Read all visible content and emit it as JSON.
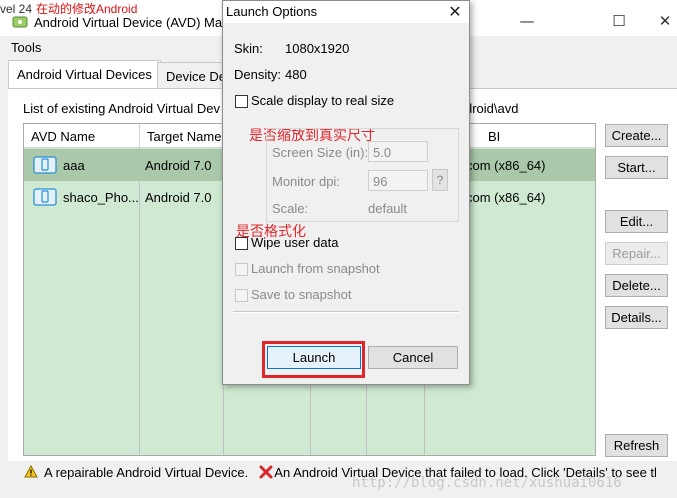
{
  "window": {
    "title": "Android Virtual Device (AVD) Ma",
    "background_fragments": {
      "left": "vel 24",
      "red": "在动的修改Android"
    },
    "buttons": {
      "minimize": "—",
      "maximize": "☐",
      "close": "✕"
    }
  },
  "menu": {
    "tools": "Tools"
  },
  "tabs": [
    {
      "label": "Android Virtual Devices",
      "active": true
    },
    {
      "label": "Device De",
      "active": false
    }
  ],
  "list": {
    "label": "List of existing Android Virtual Dev",
    "path_suffix": "droid\\avd",
    "columns": [
      "AVD Name",
      "Target Name",
      "",
      "",
      "BI"
    ],
    "rows": [
      {
        "name": "aaa",
        "target": "Android 7.0",
        "abi": "com (x86_64)",
        "selected": true,
        "icon": "device-icon"
      },
      {
        "name": "shaco_Pho...",
        "target": "Android 7.0",
        "abi": "com (x86_64)",
        "selected": false,
        "icon": "device-icon"
      }
    ]
  },
  "side_buttons": [
    {
      "label": "Create...",
      "enabled": true
    },
    {
      "label": "Start...",
      "enabled": true
    },
    {
      "label": "Edit...",
      "enabled": true
    },
    {
      "label": "Repair...",
      "enabled": false
    },
    {
      "label": "Delete...",
      "enabled": true
    },
    {
      "label": "Details...",
      "enabled": true
    },
    {
      "label": "Refresh",
      "enabled": true
    }
  ],
  "status": {
    "warning_icon": "warning-icon",
    "error_icon": "error-x-icon",
    "warning_text": "A repairable Android Virtual Device.",
    "error_text": "An Android Virtual Device that failed to load. Click 'Details' to see tl"
  },
  "watermark": "http://blog.csdn.net/xushuai0616",
  "dialog": {
    "title": "Launch Options",
    "skin_label": "Skin:",
    "skin_value": "1080x1920",
    "density_label": "Density:",
    "density_value": "480",
    "scale_display_label": "Scale display to real size",
    "scale_display_checked": false,
    "screen_size_label": "Screen Size (in):",
    "screen_size_value": "5.0",
    "monitor_dpi_label": "Monitor dpi:",
    "monitor_dpi_value": "96",
    "help_label": "?",
    "scale_label": "Scale:",
    "scale_value": "default",
    "wipe_label": "Wipe user data",
    "wipe_checked": false,
    "launch_snapshot_label": "Launch from snapshot",
    "save_snapshot_label": "Save to snapshot",
    "launch_button": "Launch",
    "cancel_button": "Cancel",
    "annotation_scale": "是否缩放到真实尺寸",
    "annotation_wipe": "是否格式化",
    "accent_red": "#e0262a"
  }
}
